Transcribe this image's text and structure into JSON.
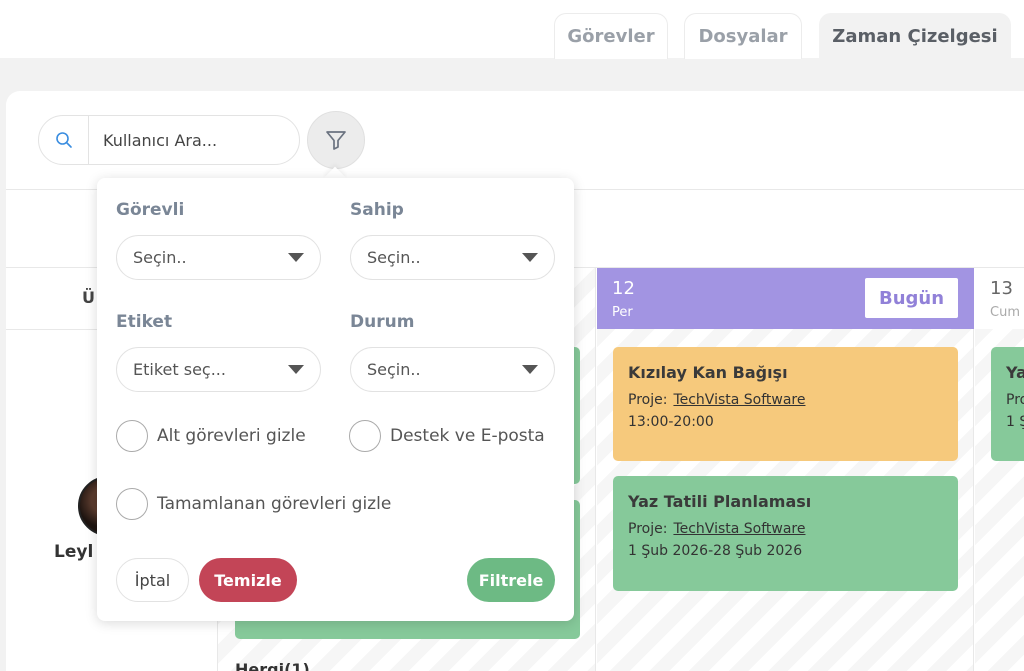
{
  "tabs": [
    {
      "label": "Görevler"
    },
    {
      "label": "Dosyalar"
    },
    {
      "label": "Zaman Çizelgesi",
      "active": true
    }
  ],
  "search": {
    "value": "Kullanıcı Ara..."
  },
  "calendar": {
    "left_header": "Ü",
    "user_name": "Leyl",
    "bottom_label": "Hergi(1)",
    "days": [
      {
        "num": "12",
        "weekday": "Per",
        "today_label": "Bugün"
      },
      {
        "num": "13",
        "weekday": "Cum"
      }
    ],
    "events": [
      {
        "title": "Kızılay Kan Bağışı",
        "project_label": "Proje:",
        "project": "TechVista Software",
        "time": "13:00-20:00"
      },
      {
        "title": "Yaz Tatili Planlaması",
        "project_label": "Proje:",
        "project": "TechVista Software",
        "time": "1 Şub 2026-28 Şub 2026"
      }
    ],
    "partial_event": {
      "title": "Ya",
      "line": "Pro",
      "time": "1 Ş"
    }
  },
  "filter": {
    "gorevli_label": "Görevli",
    "gorevli_value": "Seçin..",
    "sahip_label": "Sahip",
    "sahip_value": "Seçin..",
    "etiket_label": "Etiket",
    "etiket_value": "Etiket seç...",
    "durum_label": "Durum",
    "durum_value": "Seçin..",
    "check_alt": "Alt görevleri gizle",
    "check_destek": "Destek ve E-posta",
    "check_tamam": "Tamamlanan görevleri gizle",
    "btn_iptal": "İptal",
    "btn_temizle": "Temizle",
    "btn_filtrele": "Filtrele"
  },
  "colors": {
    "today_header": "#a294e2",
    "event_orange": "#f6c97c",
    "event_green": "#86c99a",
    "danger": "#c34557",
    "success": "#6dba84"
  },
  "icons": [
    "search-icon",
    "filter-icon",
    "chevron-down-icon"
  ]
}
